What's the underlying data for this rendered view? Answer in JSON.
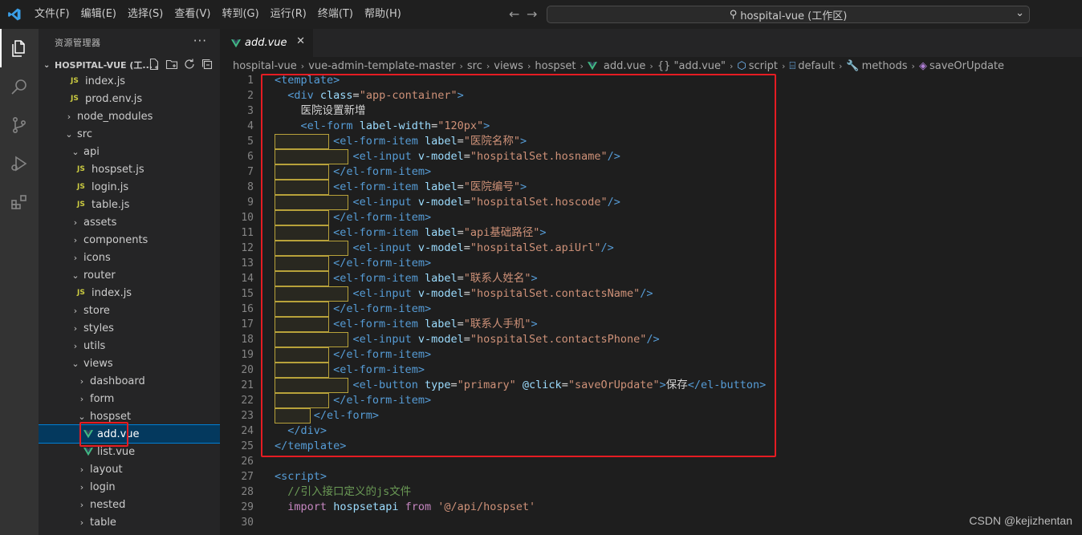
{
  "menu": [
    "文件(F)",
    "编辑(E)",
    "选择(S)",
    "查看(V)",
    "转到(G)",
    "运行(R)",
    "终端(T)",
    "帮助(H)"
  ],
  "search": {
    "label": "hospital-vue (工作区)"
  },
  "sidebar": {
    "title": "资源管理器",
    "workspace": "HOSPITAL-VUE (工...",
    "tree": [
      {
        "label": "index.js",
        "type": "js",
        "indent": 40
      },
      {
        "label": "prod.env.js",
        "type": "js",
        "indent": 40
      },
      {
        "label": "node_modules",
        "type": "folder-closed",
        "indent": 32
      },
      {
        "label": "src",
        "type": "folder-open",
        "indent": 32
      },
      {
        "label": "api",
        "type": "folder-open",
        "indent": 40
      },
      {
        "label": "hospset.js",
        "type": "js",
        "indent": 48
      },
      {
        "label": "login.js",
        "type": "js",
        "indent": 48
      },
      {
        "label": "table.js",
        "type": "js",
        "indent": 48
      },
      {
        "label": "assets",
        "type": "folder-closed",
        "indent": 40
      },
      {
        "label": "components",
        "type": "folder-closed",
        "indent": 40
      },
      {
        "label": "icons",
        "type": "folder-closed",
        "indent": 40
      },
      {
        "label": "router",
        "type": "folder-open",
        "indent": 40
      },
      {
        "label": "index.js",
        "type": "js",
        "indent": 48
      },
      {
        "label": "store",
        "type": "folder-closed",
        "indent": 40
      },
      {
        "label": "styles",
        "type": "folder-closed",
        "indent": 40
      },
      {
        "label": "utils",
        "type": "folder-closed",
        "indent": 40
      },
      {
        "label": "views",
        "type": "folder-open",
        "indent": 40
      },
      {
        "label": "dashboard",
        "type": "folder-closed",
        "indent": 48
      },
      {
        "label": "form",
        "type": "folder-closed",
        "indent": 48
      },
      {
        "label": "hospset",
        "type": "folder-open",
        "indent": 48
      },
      {
        "label": "add.vue",
        "type": "vue",
        "indent": 56,
        "selected": true
      },
      {
        "label": "list.vue",
        "type": "vue",
        "indent": 56
      },
      {
        "label": "layout",
        "type": "folder-closed",
        "indent": 48
      },
      {
        "label": "login",
        "type": "folder-closed",
        "indent": 48
      },
      {
        "label": "nested",
        "type": "folder-closed",
        "indent": 48
      },
      {
        "label": "table",
        "type": "folder-closed",
        "indent": 48
      }
    ]
  },
  "editor": {
    "tab": "add.vue",
    "breadcrumbs": [
      "hospital-vue",
      "vue-admin-template-master",
      "src",
      "views",
      "hospset",
      "add.vue",
      "{} \"add.vue\"",
      "script",
      "default",
      "methods",
      "saveOrUpdate"
    ]
  },
  "code_lines": [
    {
      "n": "1"
    },
    {
      "n": "2"
    },
    {
      "n": "3",
      "text": "医院设置新增"
    },
    {
      "n": "4"
    },
    {
      "n": "5",
      "label": "医院名称"
    },
    {
      "n": "6",
      "model": "hospitalSet.hosname"
    },
    {
      "n": "7"
    },
    {
      "n": "8",
      "label": "医院编号"
    },
    {
      "n": "9",
      "model": "hospitalSet.hoscode"
    },
    {
      "n": "10"
    },
    {
      "n": "11",
      "label": "api基础路径"
    },
    {
      "n": "12",
      "model": "hospitalSet.apiUrl"
    },
    {
      "n": "13"
    },
    {
      "n": "14",
      "label": "联系人姓名"
    },
    {
      "n": "15",
      "model": "hospitalSet.contactsName"
    },
    {
      "n": "16"
    },
    {
      "n": "17",
      "label": "联系人手机"
    },
    {
      "n": "18",
      "model": "hospitalSet.contactsPhone"
    },
    {
      "n": "19"
    },
    {
      "n": "20"
    },
    {
      "n": "21",
      "btnText": "保存"
    },
    {
      "n": "22"
    },
    {
      "n": "23"
    },
    {
      "n": "24"
    },
    {
      "n": "25"
    },
    {
      "n": "26"
    },
    {
      "n": "27"
    },
    {
      "n": "28",
      "comment": "//引入接口定义的js文件"
    },
    {
      "n": "29"
    },
    {
      "n": "30"
    }
  ],
  "code_values": {
    "container_class": "\"app-container\"",
    "label_width": "\"120px\"",
    "button_type": "\"primary\"",
    "click_handler": "\"saveOrUpdate\"",
    "import_module": "hospsetapi",
    "import_path": "'@/api/hospset'"
  },
  "watermark": "CSDN @kejizhentan"
}
